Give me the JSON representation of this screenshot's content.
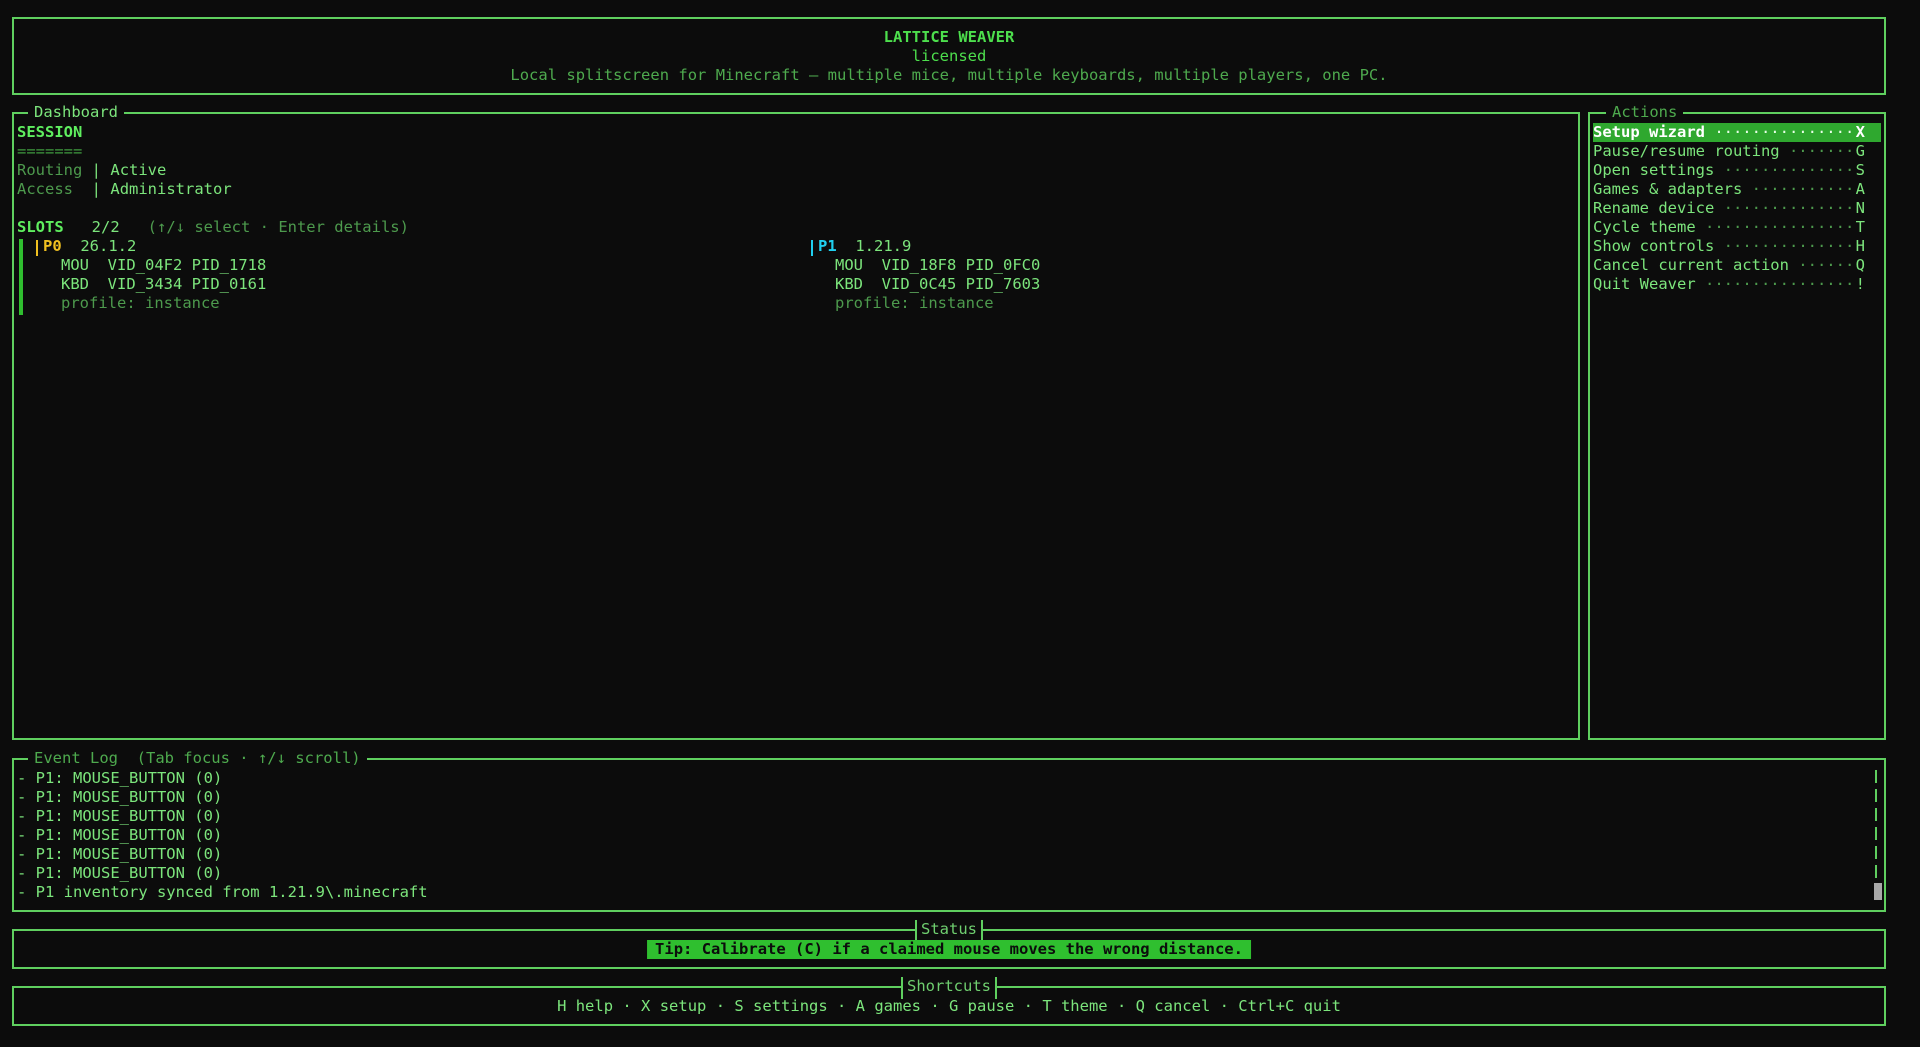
{
  "header": {
    "title": "LATTICE WEAVER",
    "subtitle": "licensed",
    "tagline": "Local splitscreen for Minecraft — multiple mice, multiple keyboards, multiple players, one PC."
  },
  "dashboard": {
    "title": "Dashboard",
    "session_heading": "SESSION",
    "session_underline": "=======",
    "routing_label": "Routing",
    "routing_value": "Active",
    "access_label": "Access ",
    "access_value": "Administrator",
    "separator": "|",
    "slots_label": "SLOTS",
    "slots_count": "2/2",
    "slots_hint": "(↑/↓ select · Enter details)",
    "slots": [
      {
        "id": "P0",
        "version": "26.1.2",
        "mouse_label": "MOU",
        "mouse": "VID_04F2 PID_1718",
        "keyboard_label": "KBD",
        "keyboard": "VID_3434 PID_0161",
        "profile": "profile: instance",
        "color": "#f0c020"
      },
      {
        "id": "P1",
        "version": "1.21.9",
        "mouse_label": "MOU",
        "mouse": "VID_18F8 PID_0FC0",
        "keyboard_label": "KBD",
        "keyboard": "VID_0C45 PID_7603",
        "profile": "profile: instance",
        "color": "#20d0f0"
      }
    ]
  },
  "actions": {
    "title": "Actions",
    "items": [
      {
        "label": "Setup wizard",
        "leader": " ··············· ",
        "key": "X",
        "selected": true
      },
      {
        "label": "Pause/resume routing",
        "leader": " ······· ",
        "key": "G"
      },
      {
        "label": "Open settings",
        "leader": " ·············· ",
        "key": "S"
      },
      {
        "label": "Games & adapters",
        "leader": " ··········· ",
        "key": "A"
      },
      {
        "label": "Rename device",
        "leader": " ·············· ",
        "key": "N"
      },
      {
        "label": "Cycle theme",
        "leader": " ················ ",
        "key": "T"
      },
      {
        "label": "Show controls",
        "leader": " ·············· ",
        "key": "H"
      },
      {
        "label": "Cancel current action",
        "leader": " ······ ",
        "key": "Q"
      },
      {
        "label": "Quit Weaver",
        "leader": " ················ ",
        "key": "!"
      }
    ]
  },
  "event_log": {
    "title": "Event Log  (Tab focus · ↑/↓ scroll)",
    "lines": [
      "- P1: MOUSE_BUTTON (0)",
      "- P1: MOUSE_BUTTON (0)",
      "- P1: MOUSE_BUTTON (0)",
      "- P1: MOUSE_BUTTON (0)",
      "- P1: MOUSE_BUTTON (0)",
      "- P1: MOUSE_BUTTON (0)",
      "- P1 inventory synced from 1.21.9\\.minecraft"
    ]
  },
  "status": {
    "title": "Status",
    "tip": "Tip: Calibrate (C) if a claimed mouse moves the wrong distance."
  },
  "shortcuts": {
    "title": "Shortcuts",
    "text": "H help · X setup · S settings · A games · G pause · T theme · Q cancel · Ctrl+C quit"
  },
  "colors": {
    "accent": "#5fcf5f",
    "background": "#0c0c0c",
    "selected_bg": "#2fa82f",
    "p0": "#f0c020",
    "p1": "#20d0f0"
  }
}
